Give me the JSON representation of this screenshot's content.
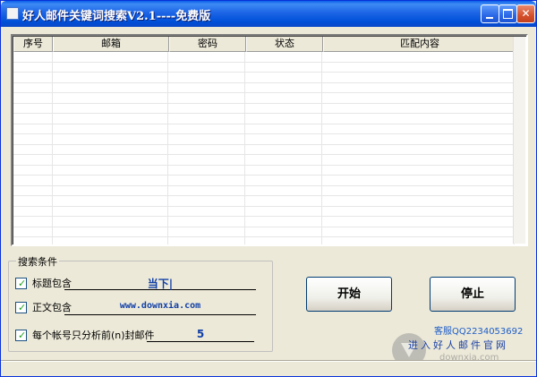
{
  "window": {
    "title": "好人邮件关键词搜索V2.1----免费版"
  },
  "list": {
    "columns": [
      "序号",
      "邮箱",
      "密码",
      "状态",
      "匹配内容"
    ],
    "row_count": 20
  },
  "search": {
    "group_label": "搜索条件",
    "subject_label": "标题包含",
    "subject_value": "当下|",
    "body_label": "正文包含",
    "body_value": "www.downxia.com",
    "limit_label": "每个帐号只分析前(n)封邮件",
    "limit_value": "5",
    "subject_checked": true,
    "body_checked": true,
    "limit_checked": true
  },
  "buttons": {
    "start": "开始",
    "stop": "停止"
  },
  "footer": {
    "support": "客服QQ2234053692",
    "enter_site": "进入好人邮件官网",
    "watermark_sub": "downxia.com"
  },
  "colors": {
    "titlebar": "#0a5ee8",
    "window_bg": "#ece9d8",
    "field_text": "#1240a8",
    "support_text": "#1f5ec9"
  }
}
